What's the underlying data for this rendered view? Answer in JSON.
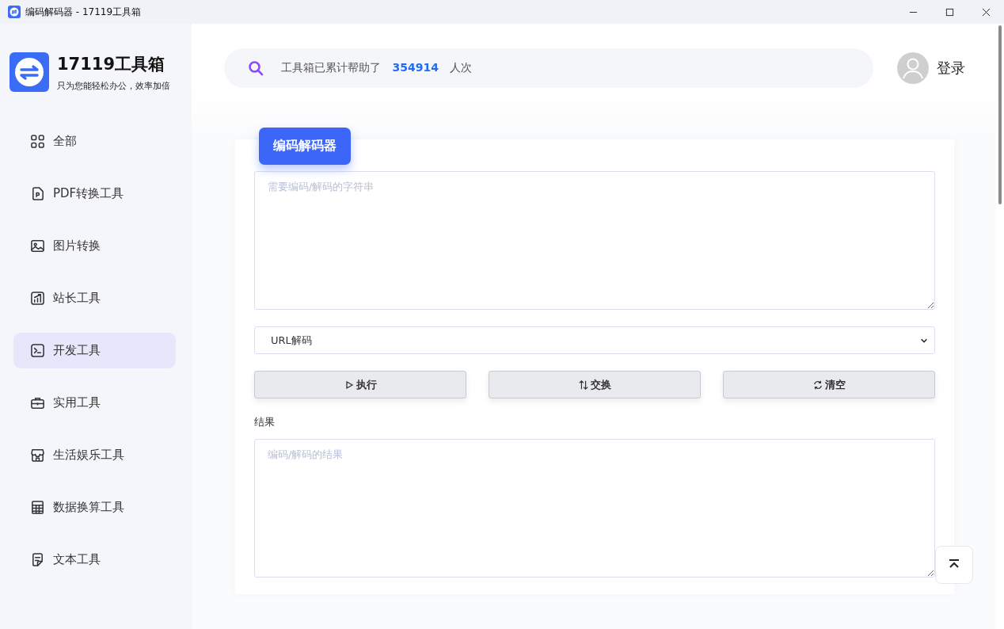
{
  "window": {
    "title": "编码解码器 - 17119工具箱"
  },
  "sidebar": {
    "logo": {
      "title": "17119工具箱",
      "subtitle": "只为您能轻松办公，效率加倍"
    },
    "items": [
      {
        "label": "全部",
        "selected": false
      },
      {
        "label": "PDF转换工具",
        "selected": false
      },
      {
        "label": "图片转换",
        "selected": false
      },
      {
        "label": "站长工具",
        "selected": false
      },
      {
        "label": "开发工具",
        "selected": true
      },
      {
        "label": "实用工具",
        "selected": false
      },
      {
        "label": "生活娱乐工具",
        "selected": false
      },
      {
        "label": "数据换算工具",
        "selected": false
      },
      {
        "label": "文本工具",
        "selected": false
      }
    ]
  },
  "header": {
    "stats": "工具箱已累计帮助了 **354914** 人次",
    "login": "登录"
  },
  "tool": {
    "title": "编码解码器",
    "input": {
      "placeholder": "需要编码/解码的字符串"
    },
    "mode": {
      "value": "URL解码"
    },
    "buttons": [
      "执行",
      "交换",
      "清空"
    ],
    "result": {
      "label": "结果",
      "placeholder": "编码/解码的结果"
    }
  }
}
